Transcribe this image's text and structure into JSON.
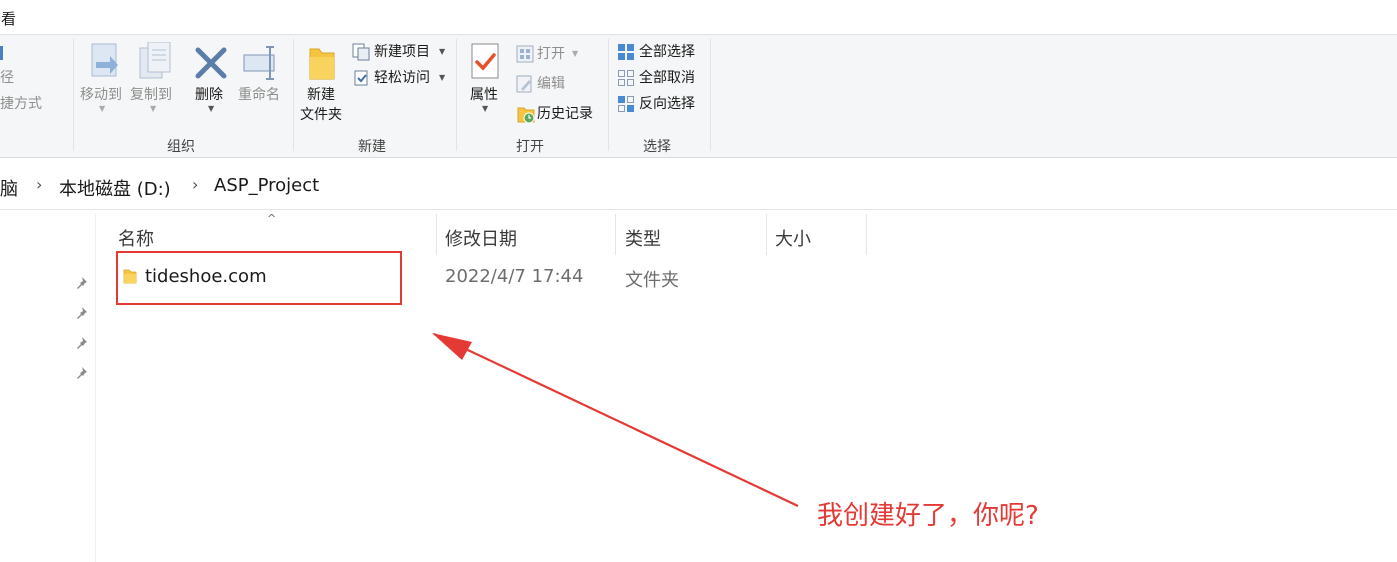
{
  "tabs": {
    "view": "查看"
  },
  "ribbon": {
    "clipboard": {
      "copy_path": "路径",
      "paste_shortcut": "快捷方式"
    },
    "organize": {
      "label": "组织",
      "move_to": "移动到",
      "copy_to": "复制到",
      "delete": "删除",
      "rename": "重命名"
    },
    "new": {
      "label": "新建",
      "new_folder_line1": "新建",
      "new_folder_line2": "文件夹",
      "new_item": "新建项目",
      "easy_access": "轻松访问"
    },
    "open": {
      "label": "打开",
      "properties": "属性",
      "open": "打开",
      "edit": "编辑",
      "history": "历史记录"
    },
    "select": {
      "label": "选择",
      "select_all": "全部选择",
      "select_none": "全部取消",
      "invert": "反向选择"
    }
  },
  "address": {
    "crumbs": [
      "电脑",
      "本地磁盘 (D:)",
      "ASP_Project"
    ]
  },
  "columns": {
    "name": "名称",
    "modified": "修改日期",
    "type": "类型",
    "size": "大小"
  },
  "files": [
    {
      "name": "tideshoe.com",
      "modified": "2022/4/7 17:44",
      "type": "文件夹",
      "size": ""
    }
  ],
  "annotation": "我创建好了，你呢?",
  "colors": {
    "accent": "#e53935",
    "folder": "#f5c542"
  }
}
